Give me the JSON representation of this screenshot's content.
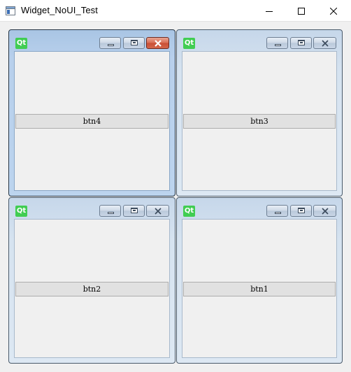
{
  "window": {
    "title": "Widget_NoUI_Test",
    "icon": "app-window-icon",
    "controls": {
      "minimize": "minimize-icon",
      "maximize": "maximize-icon",
      "close": "close-icon"
    }
  },
  "subwindows": [
    {
      "id": "top-left",
      "icon": "qt-logo-icon",
      "icon_text": "Qt",
      "button_label": "btn4",
      "active": true
    },
    {
      "id": "top-right",
      "icon": "qt-logo-icon",
      "icon_text": "Qt",
      "button_label": "btn3",
      "active": false
    },
    {
      "id": "bottom-left",
      "icon": "qt-logo-icon",
      "icon_text": "Qt",
      "button_label": "btn2",
      "active": false
    },
    {
      "id": "bottom-right",
      "icon": "qt-logo-icon",
      "icon_text": "Qt",
      "button_label": "btn1",
      "active": false
    }
  ],
  "colors": {
    "qt_green": "#41cd52",
    "active_close": "#c84e35",
    "frame_active": "#263544",
    "frame_inactive": "#4a5b6b"
  }
}
